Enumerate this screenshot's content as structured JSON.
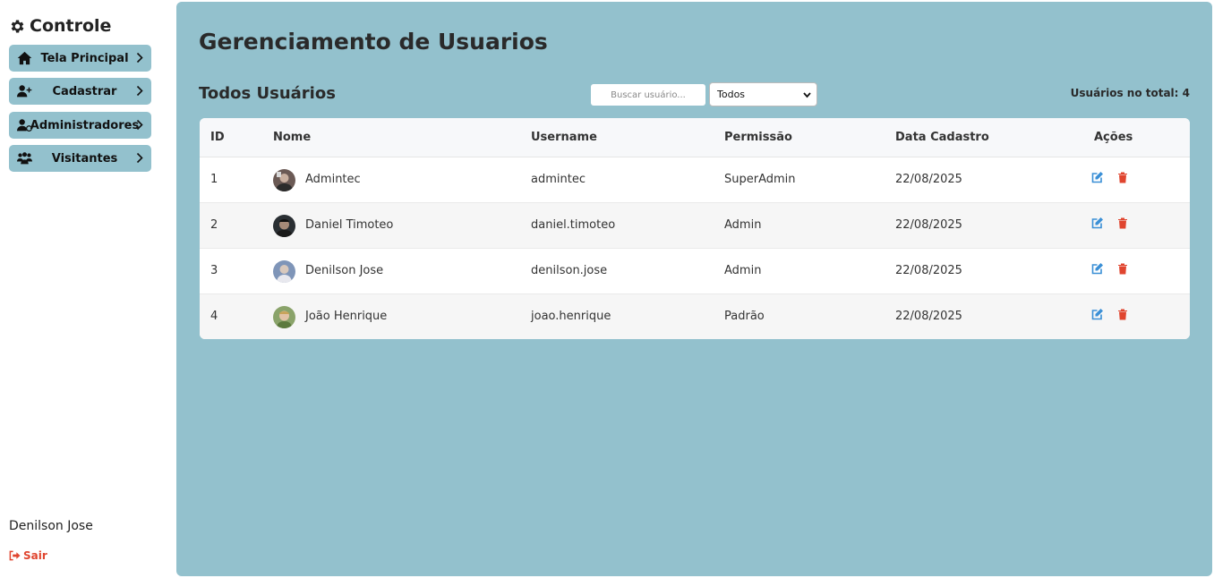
{
  "sidebar": {
    "brand": "Controle",
    "brand_icon": "gear-icon",
    "items": [
      {
        "label": "Tela Principal",
        "icon": "home-icon"
      },
      {
        "label": "Cadastrar",
        "icon": "user-plus-icon"
      },
      {
        "label": "Administradores",
        "icon": "user-shield-icon"
      },
      {
        "label": "Visitantes",
        "icon": "users-icon"
      }
    ],
    "current_user": "Denilson Jose",
    "logout_label": "Sair"
  },
  "main": {
    "title": "Gerenciamento de Usuarios",
    "section_title": "Todos Usuários",
    "search_placeholder": "Buscar usuário...",
    "filter_value": "Todos",
    "total_label": "Usuários no total: 4"
  },
  "table": {
    "headers": [
      "ID",
      "Nome",
      "Username",
      "Permissão",
      "Data Cadastro",
      "Ações"
    ],
    "rows": [
      {
        "id": "1",
        "name": "Admintec",
        "username": "admintec",
        "permission": "SuperAdmin",
        "date": "22/08/2025"
      },
      {
        "id": "2",
        "name": "Daniel Timoteo",
        "username": "daniel.timoteo",
        "permission": "Admin",
        "date": "22/08/2025"
      },
      {
        "id": "3",
        "name": "Denilson Jose",
        "username": "denilson.jose",
        "permission": "Admin",
        "date": "22/08/2025"
      },
      {
        "id": "4",
        "name": "João Henrique",
        "username": "joao.henrique",
        "permission": "Padrão",
        "date": "22/08/2025"
      }
    ]
  },
  "colors": {
    "panel_bg": "#93c1cd",
    "edit_icon": "#3a8fd6",
    "delete_icon": "#e0452f",
    "logout": "#e0452f"
  }
}
